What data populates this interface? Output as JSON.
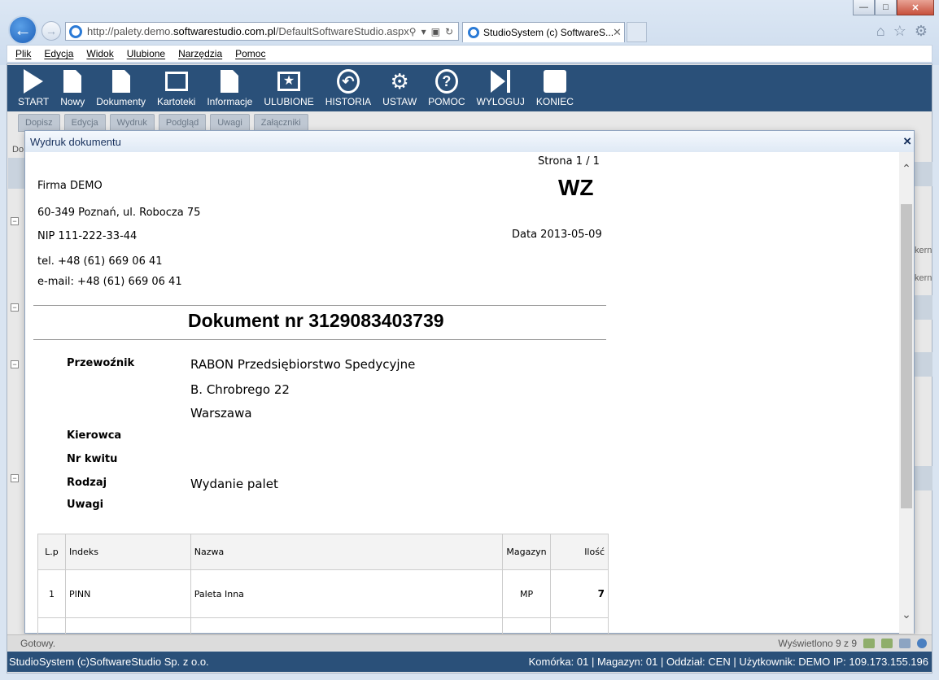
{
  "browser": {
    "url_prefix": "http://palety.demo.",
    "url_domain": "softwarestudio.com.pl",
    "url_suffix": "/DefaultSoftwareStudio.aspx?rol",
    "tab_title": "StudioSystem (c) SoftwareS...",
    "menu": [
      "Plik",
      "Edycja",
      "Widok",
      "Ulubione",
      "Narzędzia",
      "Pomoc"
    ]
  },
  "toolbar": {
    "start": "START",
    "nowy": "Nowy",
    "dokumenty": "Dokumenty",
    "kartoteki": "Kartoteki",
    "informacje": "Informacje",
    "ulubione": "ULUBIONE",
    "historia": "HISTORIA",
    "ustaw": "USTAW",
    "pomoc": "POMOC",
    "wyloguj": "WYLOGUJ",
    "koniec": "KONIEC"
  },
  "subtoolbar": [
    "Dopisz",
    "Edycja",
    "Wydruk",
    "Podgląd",
    "Uwagi",
    "Załączniki"
  ],
  "background": {
    "left_label": "Do",
    "right_snippet": "kern"
  },
  "dialog": {
    "title": "Wydruk dokumentu",
    "close": "×"
  },
  "document": {
    "page": "Strona 1 / 1",
    "company": "Firma DEMO",
    "address": "60-349 Poznań, ul. Robocza 75",
    "nip": "NIP 111-222-33-44",
    "tel": "tel. +48 (61) 669 06 41",
    "email": "e-mail: +48 (61) 669 06 41",
    "doc_type": "WZ",
    "date": "Data 2013-05-09",
    "doc_number": "Dokument nr 3129083403739",
    "carrier_label": "Przewoźnik",
    "carrier_name": "RABON Przedsiębiorstwo Spedycyjne",
    "carrier_street": "B. Chrobrego 22",
    "carrier_city": "Warszawa",
    "driver_label": "Kierowca",
    "receipt_label": "Nr kwitu",
    "type_label": "Rodzaj",
    "type_value": "Wydanie palet",
    "notes_label": "Uwagi",
    "table": {
      "headers": {
        "lp": "L.p",
        "indeks": "Indeks",
        "nazwa": "Nazwa",
        "magazyn": "Magazyn",
        "ilosc": "Ilość"
      },
      "rows": [
        {
          "lp": "1",
          "indeks": "PINN",
          "nazwa": "Paleta Inna",
          "magazyn": "MP",
          "ilosc": "7"
        }
      ]
    }
  },
  "status": {
    "left": "Gotowy.",
    "right": "Wyświetlono 9 z 9"
  },
  "footer": {
    "left": "StudioSystem (c)SoftwareStudio Sp. z o.o.",
    "right": "Komórka: 01 | Magazyn: 01 | Oddział: CEN | Użytkownik: DEMO IP: 109.173.155.196"
  }
}
